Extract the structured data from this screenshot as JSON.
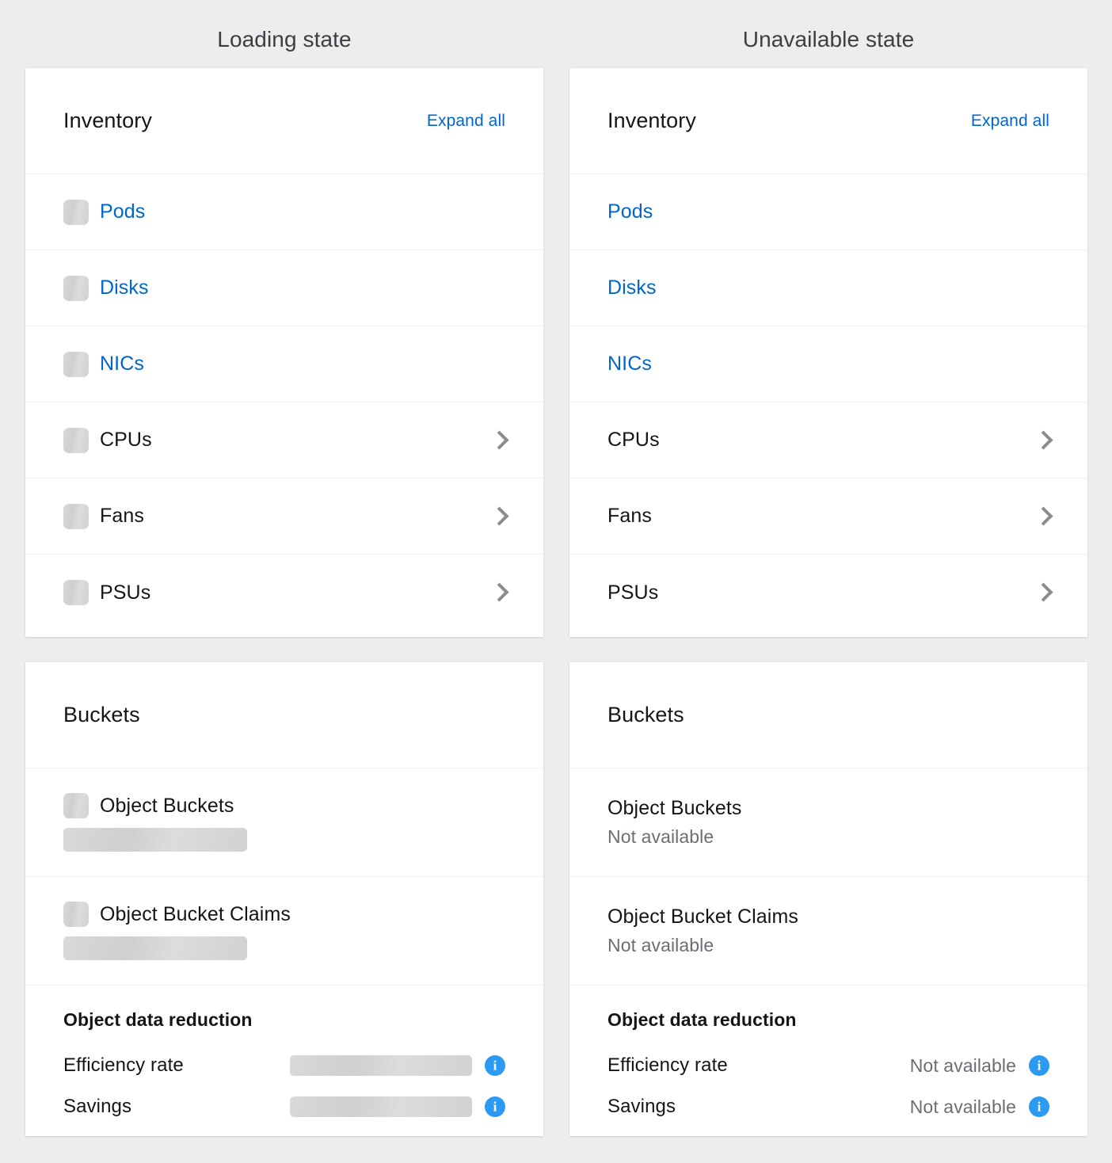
{
  "columns": [
    {
      "heading": "Loading state",
      "state": "loading"
    },
    {
      "heading": "Unavailable state",
      "state": "unavailable"
    }
  ],
  "colors": {
    "page_background": "#ededed",
    "card_background": "#ffffff",
    "link_blue": "#0066cc",
    "info_icon_blue": "#2b9af3",
    "text_primary": "#151515",
    "text_muted": "#6a6e73",
    "skeleton_gray": "#d2d2d2",
    "chevron_gray": "#8a8d90",
    "divider": "#f0f0f0"
  },
  "inventory_card": {
    "title": "Inventory",
    "expand_all_label": "Expand all",
    "rows": [
      {
        "label": "Pods",
        "is_link": true,
        "has_chevron": false
      },
      {
        "label": "Disks",
        "is_link": true,
        "has_chevron": false
      },
      {
        "label": "NICs",
        "is_link": true,
        "has_chevron": false
      },
      {
        "label": "CPUs",
        "is_link": false,
        "has_chevron": true
      },
      {
        "label": "Fans",
        "is_link": false,
        "has_chevron": true
      },
      {
        "label": "PSUs",
        "is_link": false,
        "has_chevron": true
      }
    ],
    "icons": {
      "chevron": "chevron-right-icon",
      "skeleton": "skeleton-placeholder"
    }
  },
  "buckets_card": {
    "title": "Buckets",
    "rows": [
      {
        "label": "Object Buckets",
        "unavailable_value": "Not available"
      },
      {
        "label": "Object Bucket Claims",
        "unavailable_value": "Not available"
      }
    ],
    "reduction": {
      "title": "Object data reduction",
      "metrics": [
        {
          "label": "Efficiency rate",
          "unavailable_value": "Not available",
          "info_icon": "info-circle-icon"
        },
        {
          "label": "Savings",
          "unavailable_value": "Not available",
          "info_icon": "info-circle-icon"
        }
      ]
    }
  }
}
